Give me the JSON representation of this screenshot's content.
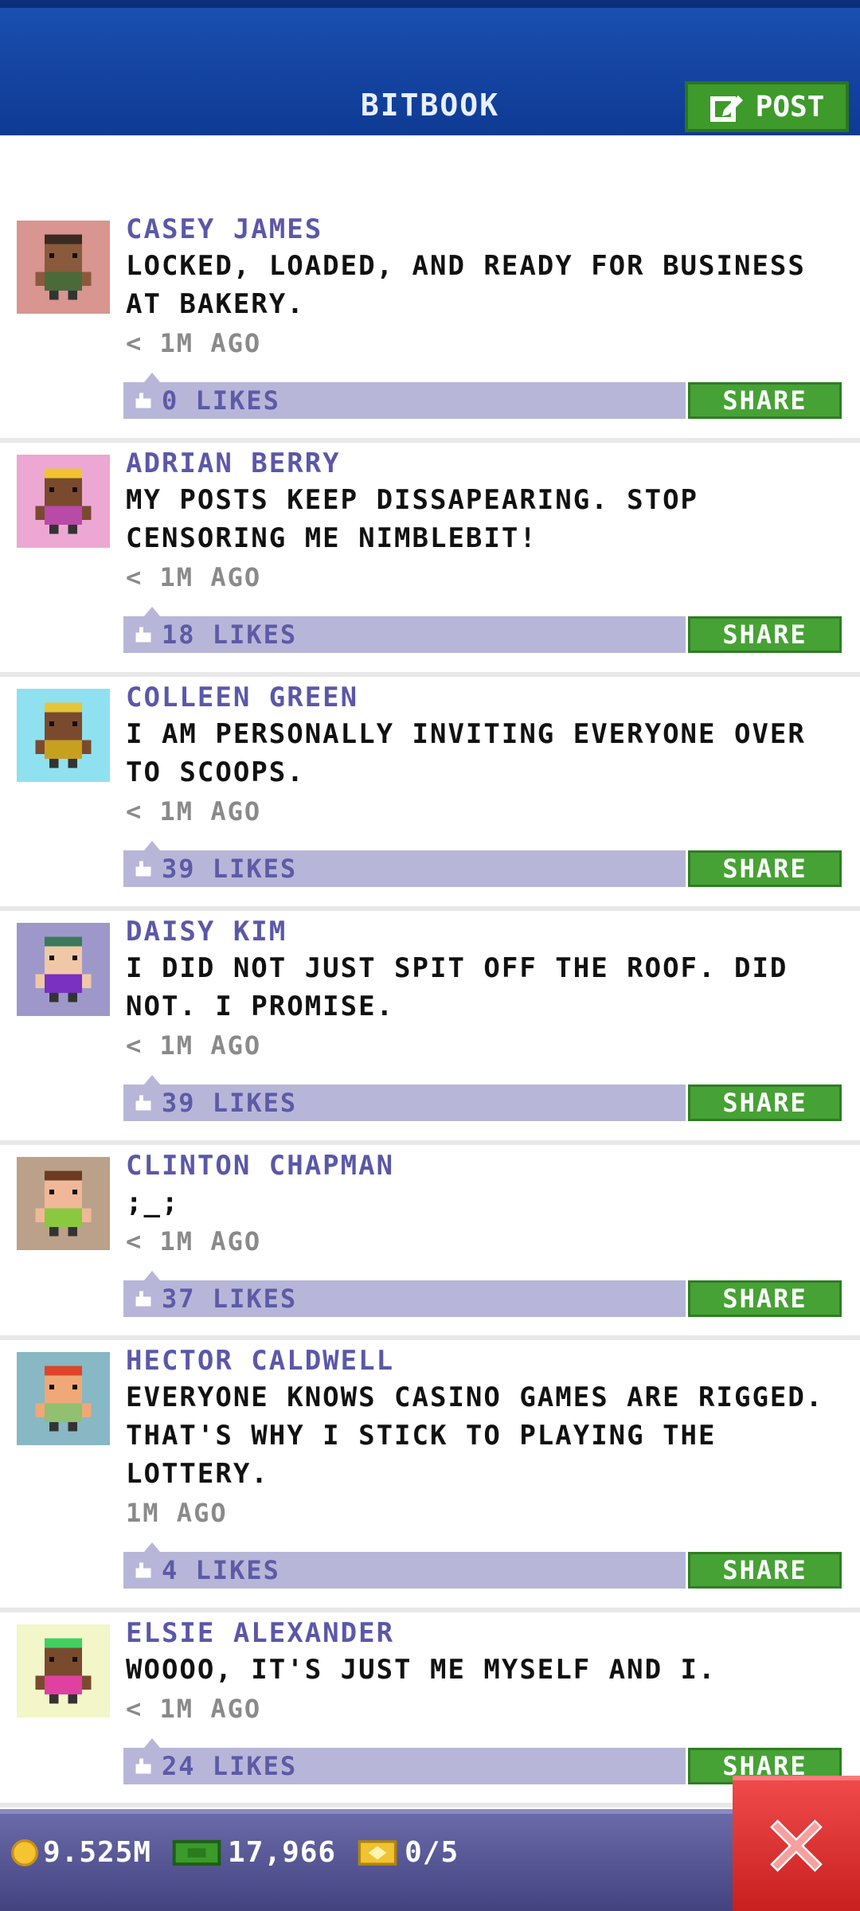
{
  "header": {
    "title": "BITBOOK",
    "post_label": "POST"
  },
  "posts": [
    {
      "name": "CASEY JAMES",
      "message": "LOCKED, LOADED, AND READY FOR BUSINESS AT BAKERY.",
      "time": "< 1M AGO",
      "likes": "0 LIKES",
      "share": "SHARE",
      "avatar_bg": "#d9958f",
      "hair": "#3a2a22",
      "skin": "#8a5a3c",
      "shirt": "#4a6a3a"
    },
    {
      "name": "ADRIAN BERRY",
      "message": "MY POSTS KEEP DISSAPEARING. STOP CENSORING ME NIMBLEBIT!",
      "time": "< 1M AGO",
      "likes": "18 LIKES",
      "share": "SHARE",
      "avatar_bg": "#eca8d2",
      "hair": "#f0c430",
      "skin": "#7a4a2e",
      "shirt": "#b84aa8"
    },
    {
      "name": "COLLEEN GREEN",
      "message": "I AM PERSONALLY INVITING EVERYONE OVER TO SCOOPS.",
      "time": "< 1M AGO",
      "likes": "39 LIKES",
      "share": "SHARE",
      "avatar_bg": "#8fe1f0",
      "hair": "#e8c43a",
      "skin": "#7a4a2e",
      "shirt": "#c8a020"
    },
    {
      "name": "DAISY KIM",
      "message": "I DID NOT JUST SPIT OFF THE ROOF. DID NOT. I PROMISE.",
      "time": "< 1M AGO",
      "likes": "39 LIKES",
      "share": "SHARE",
      "avatar_bg": "#9d98c9",
      "hair": "#3a7a5a",
      "skin": "#f0c8a8",
      "shirt": "#7a30c0"
    },
    {
      "name": "CLINTON CHAPMAN",
      "message": ";_;",
      "time": "< 1M AGO",
      "likes": "37 LIKES",
      "share": "SHARE",
      "avatar_bg": "#bba189",
      "hair": "#6a3a22",
      "skin": "#f0b898",
      "shirt": "#8ac840"
    },
    {
      "name": "HECTOR CALDWELL",
      "message": "EVERYONE KNOWS CASINO GAMES ARE RIGGED. THAT'S WHY I STICK TO PLAYING THE LOTTERY.",
      "time": "1M AGO",
      "likes": "4 LIKES",
      "share": "SHARE",
      "avatar_bg": "#87b8c4",
      "hair": "#e0442a",
      "skin": "#f0a878",
      "shirt": "#90c070"
    },
    {
      "name": "ELSIE ALEXANDER",
      "message": "WOOOO, IT'S JUST ME MYSELF AND I.",
      "time": "< 1M AGO",
      "likes": "24 LIKES",
      "share": "SHARE",
      "avatar_bg": "#f3f6c8",
      "hair": "#40d060",
      "skin": "#7a4a2e",
      "shirt": "#e040a0"
    }
  ],
  "status": {
    "coins": "9.525M",
    "bux": "17,966",
    "tickets": "0/5"
  },
  "colors": {
    "accent": "#46a234",
    "header": "#1a4fb0",
    "name": "#5b58a8",
    "likebar": "#b7b6d8",
    "close": "#e03030"
  }
}
